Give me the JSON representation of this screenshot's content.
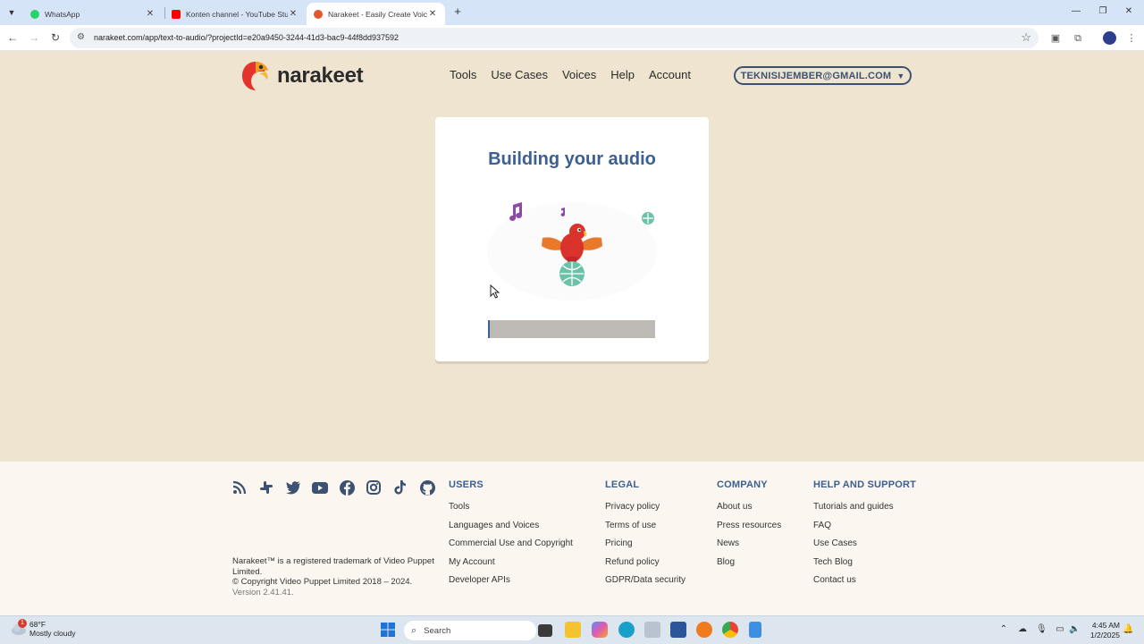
{
  "browser": {
    "tabs": [
      {
        "title": "WhatsApp",
        "icon": "whatsapp-icon",
        "color": "#25d366"
      },
      {
        "title": "Konten channel - YouTube Studio",
        "icon": "youtube-icon",
        "color": "#ff0000"
      },
      {
        "title": "Narakeet - Easily Create Voiceover",
        "icon": "narakeet-icon",
        "color": "#e4572e"
      }
    ],
    "url": "narakeet.com/app/text-to-audio/?projectId=e20a9450-3244-41d3-bac9-44f8dd937592"
  },
  "site": {
    "brand": "narakeet",
    "nav": [
      "Tools",
      "Use Cases",
      "Voices",
      "Help",
      "Account"
    ],
    "account_email": "TEKNISIJEMBER@GMAIL.COM"
  },
  "progress_card": {
    "title": "Building your audio",
    "progress_fraction": 0.01
  },
  "footer": {
    "socials": [
      "rss-icon",
      "slack-icon",
      "twitter-icon",
      "youtube-icon",
      "facebook-icon",
      "instagram-icon",
      "tiktok-icon",
      "github-icon"
    ],
    "trademark": "Narakeet™ is a registered trademark of Video Puppet Limited.",
    "copyright": "© Copyright Video Puppet Limited 2018 – 2024.",
    "version": "Version 2.41.41.",
    "columns": [
      {
        "heading": "USERS",
        "links": [
          "Tools",
          "Languages and Voices",
          "Commercial Use and Copyright",
          "My Account",
          "Developer APIs"
        ]
      },
      {
        "heading": "LEGAL",
        "links": [
          "Privacy policy",
          "Terms of use",
          "Pricing",
          "Refund policy",
          "GDPR/Data security"
        ]
      },
      {
        "heading": "COMPANY",
        "links": [
          "About us",
          "Press resources",
          "News",
          "Blog"
        ]
      },
      {
        "heading": "HELP AND SUPPORT",
        "links": [
          "Tutorials and guides",
          "FAQ",
          "Use Cases",
          "Tech Blog",
          "Contact us"
        ]
      }
    ]
  },
  "taskbar": {
    "weather_temp": "68°F",
    "weather_desc": "Mostly cloudy",
    "weather_badge": "1",
    "search_placeholder": "Search",
    "time": "4:45 AM",
    "date": "1/2/2025"
  }
}
